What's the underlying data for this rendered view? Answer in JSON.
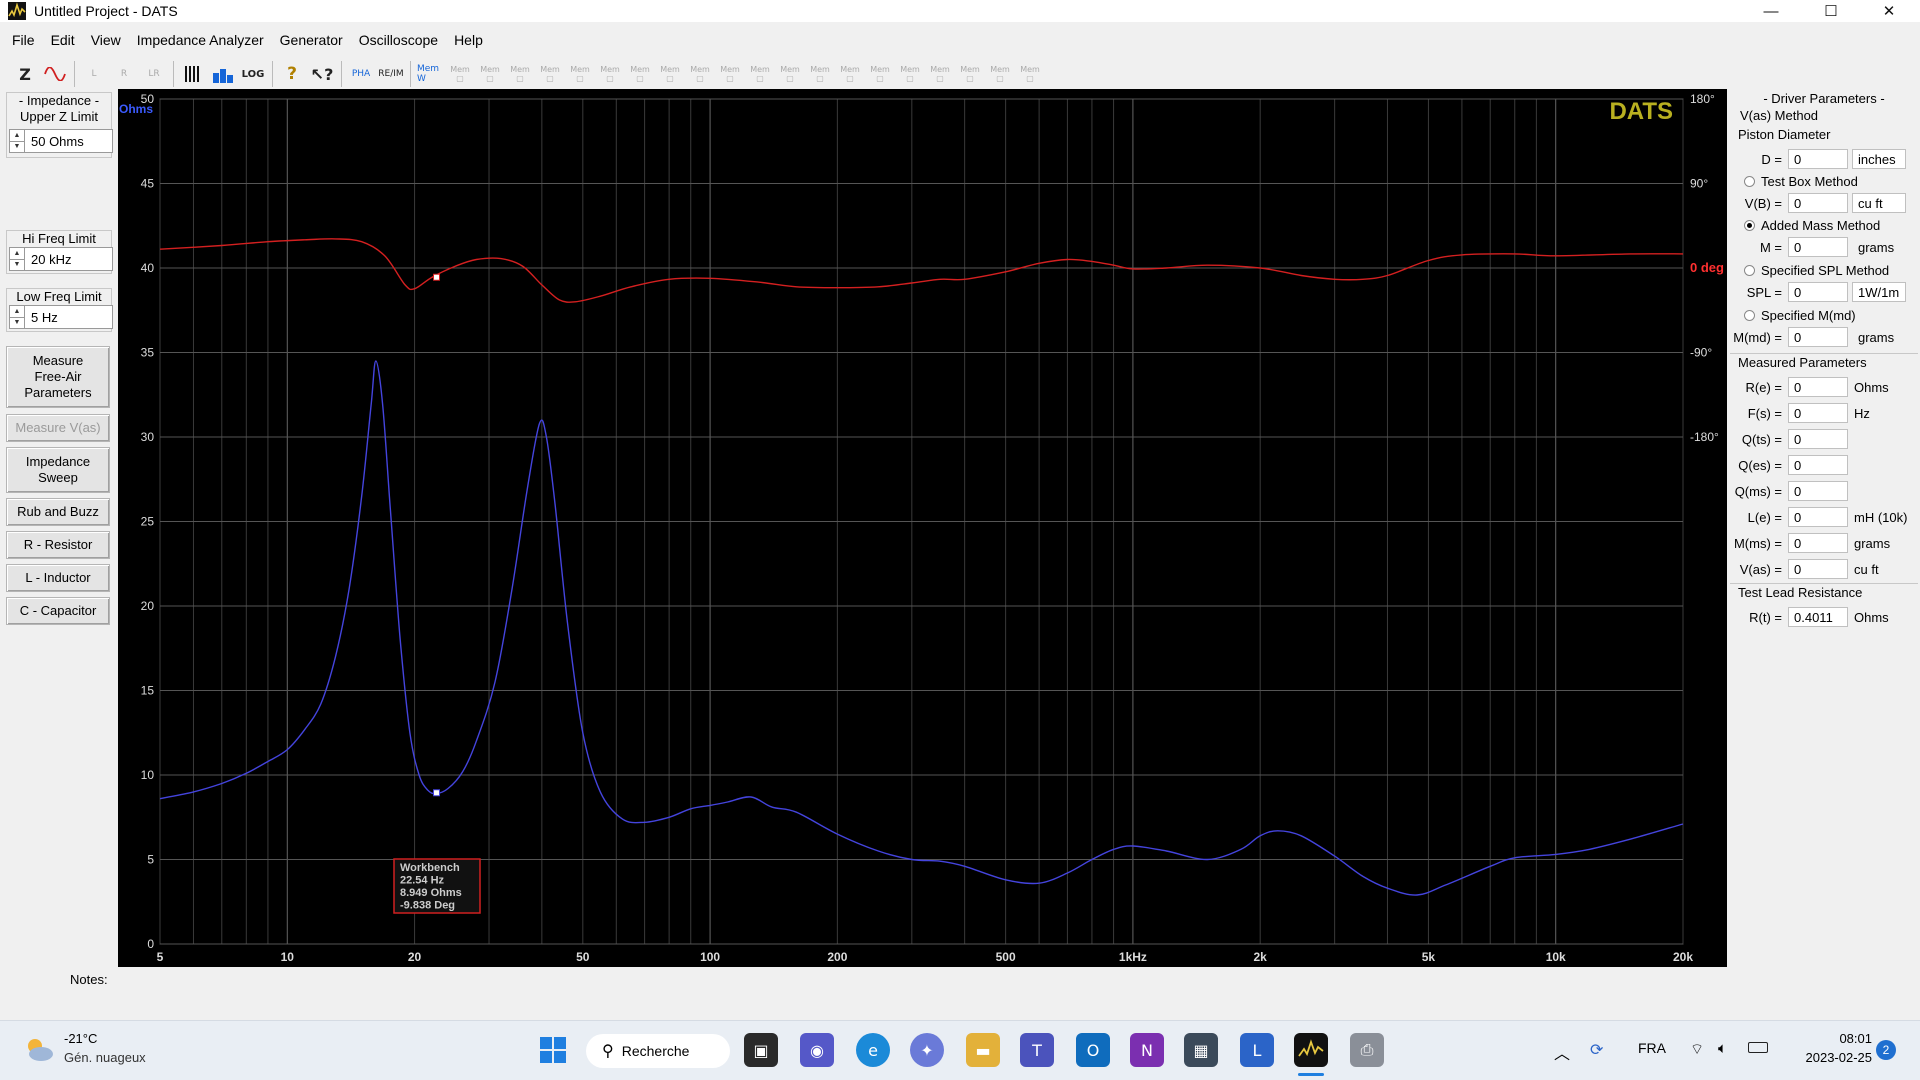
{
  "window": {
    "title": "Untitled Project - DATS",
    "minimize_glyph": "—",
    "maximize_glyph": "☐",
    "close_glyph": "✕"
  },
  "menu": [
    "File",
    "Edit",
    "View",
    "Impedance Analyzer",
    "Generator",
    "Oscilloscope",
    "Help"
  ],
  "toolbar": {
    "z_label": "Z",
    "log_label": "LOG",
    "pha_label": "PHA",
    "mem_label": "Mem",
    "mem_count": 20
  },
  "left_panel": {
    "impedance_title": "- Impedance -",
    "upper_z_title": "Upper Z Limit",
    "upper_z_value": "50 Ohms",
    "hi_freq_title": "Hi Freq Limit",
    "hi_freq_value": "20 kHz",
    "low_freq_title": "Low Freq Limit",
    "low_freq_value": "5 Hz",
    "buttons": [
      "Measure Free-Air Parameters",
      "Measure V(as)",
      "Impedance Sweep",
      "Rub and Buzz",
      "R - Resistor",
      "L - Inductor",
      "C - Capacitor"
    ]
  },
  "chart_data": {
    "type": "line",
    "watermark": "DATS",
    "y_unit": "Ohms",
    "y_phase_unit": "0 deg",
    "x_scale": "log",
    "xlim": [
      5,
      20000
    ],
    "ylim": [
      0,
      50
    ],
    "phase_lim": [
      -180,
      180
    ],
    "grid": true,
    "y_ticks": [
      "0",
      "5",
      "10",
      "15",
      "20",
      "25",
      "30",
      "35",
      "40",
      "45",
      "50"
    ],
    "phase_ticks": [
      "180°",
      "90°",
      "0 deg",
      "-90°",
      "-180°"
    ],
    "x_ticks": [
      {
        "value": 5,
        "label": "5"
      },
      {
        "value": 10,
        "label": "10"
      },
      {
        "value": 20,
        "label": "20"
      },
      {
        "value": 50,
        "label": "50"
      },
      {
        "value": 100,
        "label": "100"
      },
      {
        "value": 200,
        "label": "200"
      },
      {
        "value": 500,
        "label": "500"
      },
      {
        "value": 1000,
        "label": "1kHz"
      },
      {
        "value": 2000,
        "label": "2k"
      },
      {
        "value": 5000,
        "label": "5k"
      },
      {
        "value": 10000,
        "label": "10k"
      },
      {
        "value": 20000,
        "label": "20k"
      }
    ],
    "series": [
      {
        "color": "#4444dd",
        "axis": "impedance",
        "points": [
          [
            5,
            8.6
          ],
          [
            6,
            9.0
          ],
          [
            7,
            9.5
          ],
          [
            8,
            10.1
          ],
          [
            9,
            10.8
          ],
          [
            10,
            11.5
          ],
          [
            11,
            12.7
          ],
          [
            12,
            14.2
          ],
          [
            13,
            17
          ],
          [
            14,
            21
          ],
          [
            15,
            26.5
          ],
          [
            15.8,
            32
          ],
          [
            16.2,
            34.5
          ],
          [
            16.8,
            32
          ],
          [
            17.5,
            26
          ],
          [
            18.5,
            18
          ],
          [
            19.5,
            12.5
          ],
          [
            20.5,
            10
          ],
          [
            21.5,
            9.1
          ],
          [
            22.5,
            8.9
          ],
          [
            24,
            9.2
          ],
          [
            26,
            10.2
          ],
          [
            28,
            12
          ],
          [
            31,
            15.5
          ],
          [
            34,
            21
          ],
          [
            37,
            27
          ],
          [
            39.5,
            30.8
          ],
          [
            41,
            30
          ],
          [
            43,
            26
          ],
          [
            46,
            19
          ],
          [
            50,
            12.5
          ],
          [
            55,
            9
          ],
          [
            62,
            7.4
          ],
          [
            70,
            7.2
          ],
          [
            80,
            7.5
          ],
          [
            90,
            8.0
          ],
          [
            100,
            8.2
          ],
          [
            110,
            8.4
          ],
          [
            125,
            8.7
          ],
          [
            140,
            8.1
          ],
          [
            160,
            7.8
          ],
          [
            200,
            6.5
          ],
          [
            250,
            5.5
          ],
          [
            300,
            5.0
          ],
          [
            350,
            4.9
          ],
          [
            400,
            4.6
          ],
          [
            500,
            3.8
          ],
          [
            600,
            3.6
          ],
          [
            700,
            4.2
          ],
          [
            800,
            5.0
          ],
          [
            900,
            5.6
          ],
          [
            1000,
            5.8
          ],
          [
            1200,
            5.5
          ],
          [
            1500,
            5.0
          ],
          [
            1800,
            5.6
          ],
          [
            2000,
            6.4
          ],
          [
            2200,
            6.7
          ],
          [
            2500,
            6.4
          ],
          [
            3000,
            5.2
          ],
          [
            3500,
            4.0
          ],
          [
            4000,
            3.3
          ],
          [
            4700,
            2.9
          ],
          [
            5500,
            3.5
          ],
          [
            7000,
            4.6
          ],
          [
            8000,
            5.1
          ],
          [
            10000,
            5.3
          ],
          [
            12000,
            5.6
          ],
          [
            15000,
            6.2
          ],
          [
            20000,
            7.1
          ]
        ]
      },
      {
        "color": "#d42020",
        "axis": "phase",
        "points": [
          [
            5,
            20
          ],
          [
            7,
            24
          ],
          [
            9,
            28
          ],
          [
            11,
            30
          ],
          [
            13,
            31
          ],
          [
            15,
            28
          ],
          [
            17,
            13
          ],
          [
            19,
            -18
          ],
          [
            20,
            -22
          ],
          [
            22,
            -9.8
          ],
          [
            25,
            2
          ],
          [
            28,
            9
          ],
          [
            32,
            10
          ],
          [
            36,
            2
          ],
          [
            40,
            -18
          ],
          [
            44,
            -34
          ],
          [
            48,
            -36
          ],
          [
            55,
            -30
          ],
          [
            65,
            -20
          ],
          [
            80,
            -12
          ],
          [
            100,
            -11
          ],
          [
            130,
            -15
          ],
          [
            160,
            -20
          ],
          [
            200,
            -21
          ],
          [
            250,
            -20
          ],
          [
            300,
            -16
          ],
          [
            350,
            -12
          ],
          [
            400,
            -12
          ],
          [
            500,
            -4
          ],
          [
            600,
            5
          ],
          [
            700,
            9
          ],
          [
            800,
            7
          ],
          [
            900,
            3
          ],
          [
            1000,
            -1
          ],
          [
            1200,
            0
          ],
          [
            1500,
            3
          ],
          [
            2000,
            0
          ],
          [
            2500,
            -8
          ],
          [
            3000,
            -12
          ],
          [
            3500,
            -12
          ],
          [
            4000,
            -8
          ],
          [
            5000,
            8
          ],
          [
            6000,
            14
          ],
          [
            8000,
            15
          ],
          [
            10000,
            13
          ],
          [
            15000,
            15
          ],
          [
            20000,
            15
          ]
        ]
      }
    ],
    "cursor": {
      "freq": 22.54,
      "ohms": 8.949,
      "deg": -9.838
    },
    "tooltip": [
      "Workbench",
      "22.54 Hz",
      "8.949 Ohms",
      "-9.838 Deg"
    ]
  },
  "right_panel": {
    "driver_title": "- Driver Parameters -",
    "vas_method_title": "V(as) Method",
    "piston_title": "Piston Diameter",
    "d_label": "D =",
    "d_value": "0",
    "d_unit": "inches",
    "test_box_label": "Test Box Method",
    "vb_label": "V(B) =",
    "vb_value": "0",
    "vb_unit": "cu ft",
    "added_mass_label": "Added Mass Method",
    "m_label": "M =",
    "m_value": "0",
    "m_unit": "grams",
    "spl_method_label": "Specified SPL Method",
    "spl_label": "SPL =",
    "spl_value": "0",
    "spl_unit": "1W/1m",
    "mmd_method_label": "Specified M(md)",
    "mmd_label": "M(md) =",
    "mmd_value": "0",
    "mmd_unit": "grams",
    "measured_title": "Measured Parameters",
    "measured": [
      {
        "label": "R(e) =",
        "value": "0",
        "unit": "Ohms"
      },
      {
        "label": "F(s) =",
        "value": "0",
        "unit": "Hz"
      },
      {
        "label": "Q(ts) =",
        "value": "0",
        "unit": ""
      },
      {
        "label": "Q(es) =",
        "value": "0",
        "unit": ""
      },
      {
        "label": "Q(ms) =",
        "value": "0",
        "unit": ""
      },
      {
        "label": "L(e) =",
        "value": "0",
        "unit": "mH (10k)"
      },
      {
        "label": "M(ms) =",
        "value": "0",
        "unit": "grams"
      },
      {
        "label": "V(as) =",
        "value": "0",
        "unit": "cu ft"
      }
    ],
    "test_lead_title": "Test Lead Resistance",
    "rt_label": "R(t) =",
    "rt_value": "0.4011",
    "rt_unit": "Ohms"
  },
  "notes_label": "Notes:",
  "taskbar": {
    "weather_temp": "-21°C",
    "weather_desc": "Gén. nuageux",
    "search_label": "Recherche",
    "lang": "FRA",
    "time": "08:01",
    "date": "2023-02-25",
    "notif_count": "2",
    "colors": {
      "windows": "#1f7fe0",
      "accent": "#2b64c8"
    }
  }
}
